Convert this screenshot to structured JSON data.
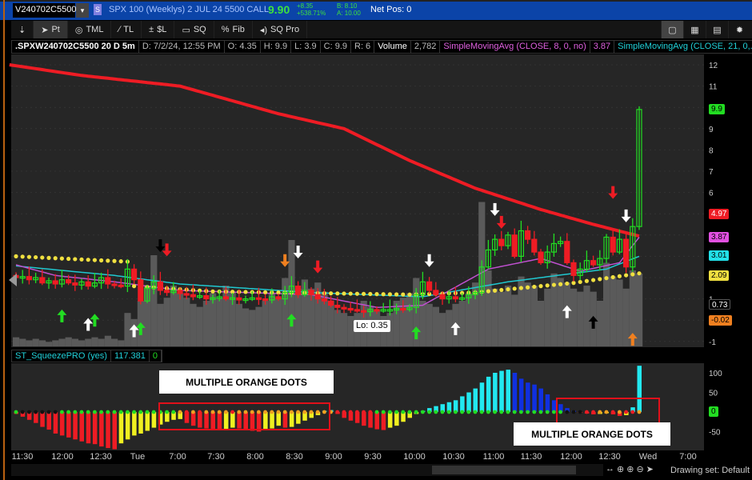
{
  "header": {
    "symbol": "V240702C5500",
    "dropdown": "▾",
    "badge": "S",
    "description": "SPX 100 (Weeklys) 2 JUL 24 5500 CALL",
    "last": "9.90",
    "change": "+8.35",
    "change_pct": "+538.71%",
    "bid": "B: 8.10",
    "ask": "A: 10.00",
    "net_pos": "Net Pos: 0"
  },
  "toolbar": {
    "items": [
      {
        "label": "",
        "icon": "pin-icon"
      },
      {
        "label": "Pt",
        "icon": "pointer-icon"
      },
      {
        "label": "TML",
        "icon": "tml-icon"
      },
      {
        "label": "TL",
        "icon": "trendline-icon"
      },
      {
        "label": "$L",
        "icon": "price-level-icon"
      },
      {
        "label": "SQ",
        "icon": "square-icon"
      },
      {
        "label": "Fib",
        "icon": "fib-icon"
      },
      {
        "label": "SQ Pro",
        "icon": "sqpro-icon"
      }
    ],
    "right": [
      "▢",
      "▦",
      "▤",
      "✹"
    ]
  },
  "info": {
    "title": ".SPXW240702C5500 20 D 5m",
    "date": "D: 7/2/24, 12:55 PM",
    "open": "O: 4.35",
    "high": "H: 9.9",
    "low": "L: 3.9",
    "close": "C: 9.9",
    "range": "R: 6",
    "volume_label": "Volume",
    "volume": "2,782",
    "sma8_label": "SimpleMovingAvg (CLOSE, 8, 0, no)",
    "sma8_value": "3.87",
    "sma21_label": "SimpleMovingAvg (CLOSE, 21, 0,..."
  },
  "price_axis": {
    "ticks": [
      "12",
      "11",
      "9",
      "8",
      "7",
      "6",
      "1",
      "-1"
    ],
    "tags": [
      {
        "text": "9.9",
        "value": 9.9,
        "bg": "#22dd22",
        "fg": "#000"
      },
      {
        "text": "4.97",
        "value": 4.97,
        "bg": "#ee1c24",
        "fg": "#fff"
      },
      {
        "text": "3.87",
        "value": 3.87,
        "bg": "#e050e0",
        "fg": "#000"
      },
      {
        "text": "3.01",
        "value": 3.01,
        "bg": "#22e0e8",
        "fg": "#000"
      },
      {
        "text": "2.09",
        "value": 2.09,
        "bg": "#f0e040",
        "fg": "#000"
      },
      {
        "text": "0.73",
        "value": 0.73,
        "bg": "#000",
        "fg": "#fff"
      },
      {
        "text": "-0.02",
        "value": -0.02,
        "bg": "#f08020",
        "fg": "#000"
      }
    ]
  },
  "lo_label": "Lo: 0.35",
  "squeeze": {
    "title": "ST_SqueezePRO (yes)",
    "value": "117.381",
    "value2": "0",
    "ticks": [
      "100",
      "50",
      "-50"
    ],
    "zero_tag": "0"
  },
  "annotations": [
    "MULTIPLE ORANGE DOTS",
    "MULTIPLE ORANGE DOTS"
  ],
  "time_labels": [
    "11:30",
    "12:00",
    "12:30",
    "Tue",
    "7:00",
    "7:30",
    "8:00",
    "8:30",
    "9:00",
    "9:30",
    "10:00",
    "10:30",
    "11:00",
    "11:30",
    "12:00",
    "12:30",
    "Wed",
    "7:00"
  ],
  "status": {
    "drawing_set": "Drawing set: Default"
  },
  "colors": {
    "up": "#22dd22",
    "down": "#ee1c24",
    "sma_long": "#ee1c24",
    "sma8": "#c050d0",
    "sma21": "#20c8d0",
    "dots": "#f0e040",
    "volume": "#5a5a5a"
  },
  "chart_data": {
    "type": "candlestick",
    "closes": [
      2.0,
      2.05,
      1.9,
      2.0,
      1.75,
      1.85,
      1.7,
      1.9,
      1.75,
      1.65,
      1.8,
      1.6,
      1.75,
      2.0,
      1.7,
      1.65,
      1.6,
      2.4,
      1.9,
      0.9,
      1.5,
      1.8,
      1.4,
      1.3,
      1.4,
      1.25,
      1.2,
      1.1,
      1.15,
      1.0,
      1.05,
      1.1,
      1.0,
      1.05,
      0.95,
      1.0,
      1.05,
      1.0,
      0.95,
      1.1,
      1.0,
      1.3,
      1.6,
      1.2,
      1.4,
      1.2,
      1.0,
      0.9,
      0.7,
      0.6,
      0.55,
      0.5,
      0.45,
      0.4,
      0.5,
      0.45,
      0.5,
      0.5,
      0.55,
      0.5,
      0.6,
      1.2,
      1.8,
      1.4,
      1.2,
      1.0,
      1.1,
      1.0,
      1.05,
      1.2,
      1.3,
      2.5,
      3.3,
      3.8,
      3.5,
      4.0,
      3.0,
      4.2,
      3.8,
      3.2,
      2.7,
      3.2,
      3.6,
      3.7,
      2.7,
      2.1,
      2.4,
      2.8,
      2.6,
      2.9,
      3.9,
      3.2,
      3.8,
      2.5,
      4.4,
      9.9
    ],
    "volume": [
      6,
      5,
      4,
      5,
      4,
      3,
      4,
      5,
      6,
      5,
      4,
      5,
      6,
      5,
      7,
      5,
      4,
      22,
      18,
      30,
      40,
      60,
      28,
      32,
      40,
      35,
      32,
      28,
      26,
      30,
      35,
      32,
      40,
      36,
      28,
      25,
      24,
      26,
      30,
      35,
      32,
      45,
      70,
      38,
      44,
      38,
      42,
      36,
      30,
      24,
      22,
      20,
      22,
      30,
      26,
      24,
      20,
      22,
      30,
      32,
      35,
      45,
      30,
      28,
      26,
      22,
      24,
      28,
      30,
      35,
      42,
      95,
      50,
      38,
      36,
      40,
      34,
      46,
      42,
      40,
      30,
      38,
      48,
      45,
      42,
      38,
      36,
      40,
      36,
      30,
      55,
      46,
      44,
      38,
      50,
      48
    ],
    "sma_long": [
      [
        -1,
        12.0
      ],
      [
        10,
        11.5
      ],
      [
        25,
        11.0
      ],
      [
        40,
        9.7
      ],
      [
        50,
        9.0
      ],
      [
        60,
        7.5
      ],
      [
        70,
        6.2
      ],
      [
        80,
        5.2
      ],
      [
        88,
        4.5
      ],
      [
        95,
        3.95
      ]
    ],
    "sma8": [
      [
        0,
        2.6
      ],
      [
        6,
        2.1
      ],
      [
        15,
        1.8
      ],
      [
        25,
        1.4
      ],
      [
        45,
        1.2
      ],
      [
        55,
        0.6
      ],
      [
        62,
        0.7
      ],
      [
        72,
        2.4
      ],
      [
        80,
        2.9
      ],
      [
        86,
        2.3
      ],
      [
        92,
        2.7
      ],
      [
        95,
        3.9
      ]
    ],
    "sma21": [
      [
        0,
        2.55
      ],
      [
        15,
        2.1
      ],
      [
        25,
        1.7
      ],
      [
        45,
        1.3
      ],
      [
        62,
        1.1
      ],
      [
        75,
        1.8
      ],
      [
        90,
        2.4
      ],
      [
        95,
        3.0
      ]
    ],
    "yellow_dots": [
      [
        0,
        3.0
      ],
      [
        17,
        2.75
      ],
      [
        18,
        1.6
      ],
      [
        30,
        1.35
      ],
      [
        60,
        1.2
      ],
      [
        70,
        1.3
      ],
      [
        85,
        1.75
      ],
      [
        95,
        2.2
      ]
    ],
    "arrows": [
      {
        "i": 7,
        "v": 0.5,
        "c": "#22dd22",
        "d": "up"
      },
      {
        "i": 12,
        "v": 0.3,
        "c": "#22dd22",
        "d": "up"
      },
      {
        "i": 19,
        "v": -0.1,
        "c": "#22dd22",
        "d": "up"
      },
      {
        "i": 42,
        "v": 0.3,
        "c": "#22dd22",
        "d": "up"
      },
      {
        "i": 61,
        "v": -0.3,
        "c": "#22dd22",
        "d": "up"
      },
      {
        "i": 11,
        "v": 0.1,
        "c": "#fff",
        "d": "up"
      },
      {
        "i": 18,
        "v": -0.2,
        "c": "#fff",
        "d": "up"
      },
      {
        "i": 67,
        "v": -0.1,
        "c": "#fff",
        "d": "up"
      },
      {
        "i": 84,
        "v": 0.7,
        "c": "#fff",
        "d": "up"
      },
      {
        "i": 88,
        "v": 0.2,
        "c": "#000",
        "d": "up"
      },
      {
        "i": 94,
        "v": -0.6,
        "c": "#f08020",
        "d": "up"
      },
      {
        "i": 23,
        "v": 3.0,
        "c": "#ee1c24",
        "d": "down"
      },
      {
        "i": 46,
        "v": 2.2,
        "c": "#ee1c24",
        "d": "down"
      },
      {
        "i": 74,
        "v": 4.3,
        "c": "#ee1c24",
        "d": "down"
      },
      {
        "i": 91,
        "v": 5.7,
        "c": "#ee1c24",
        "d": "down"
      },
      {
        "i": 22,
        "v": 3.2,
        "c": "#000",
        "d": "down"
      },
      {
        "i": 43,
        "v": 2.9,
        "c": "#fff",
        "d": "down"
      },
      {
        "i": 63,
        "v": 2.5,
        "c": "#fff",
        "d": "down"
      },
      {
        "i": 73,
        "v": 4.9,
        "c": "#fff",
        "d": "down"
      },
      {
        "i": 93,
        "v": 4.6,
        "c": "#fff",
        "d": "down"
      },
      {
        "i": 41,
        "v": 2.5,
        "c": "#f08020",
        "d": "down"
      }
    ],
    "squeeze_hist": [
      -5,
      -12,
      -20,
      -28,
      -38,
      -45,
      -55,
      -60,
      -65,
      -70,
      -75,
      -80,
      -82,
      -88,
      -92,
      -95,
      -80,
      -70,
      -60,
      -55,
      -48,
      -40,
      -32,
      -25,
      -20,
      -18,
      -28,
      -35,
      -40,
      -42,
      -44,
      -45,
      -45,
      -40,
      -42,
      -46,
      -48,
      -50,
      -45,
      -42,
      -35,
      -40,
      -38,
      -30,
      -22,
      -15,
      -8,
      3,
      5,
      -5,
      -15,
      -22,
      -28,
      -35,
      -40,
      -44,
      -46,
      -40,
      -35,
      -25,
      -15,
      -5,
      3,
      10,
      15,
      20,
      25,
      30,
      40,
      50,
      60,
      75,
      90,
      100,
      105,
      108,
      100,
      85,
      75,
      70,
      60,
      45,
      30,
      20,
      10,
      3,
      -2,
      -4,
      -6,
      -5,
      -3,
      -6,
      -10,
      -8,
      12,
      118
    ],
    "squeeze_dots": "GKKKKKKGGGGGGGGGGGGGGGGGGOROROOOOROOOOOOOOOOOOOOORRRRRRGGGGGGGGGGGGGGGGGGGGGGGGGGGGGKKKRROORORROG",
    "price_range": [
      -1.3,
      12.5
    ],
    "squeeze_range": [
      -100,
      120
    ]
  }
}
